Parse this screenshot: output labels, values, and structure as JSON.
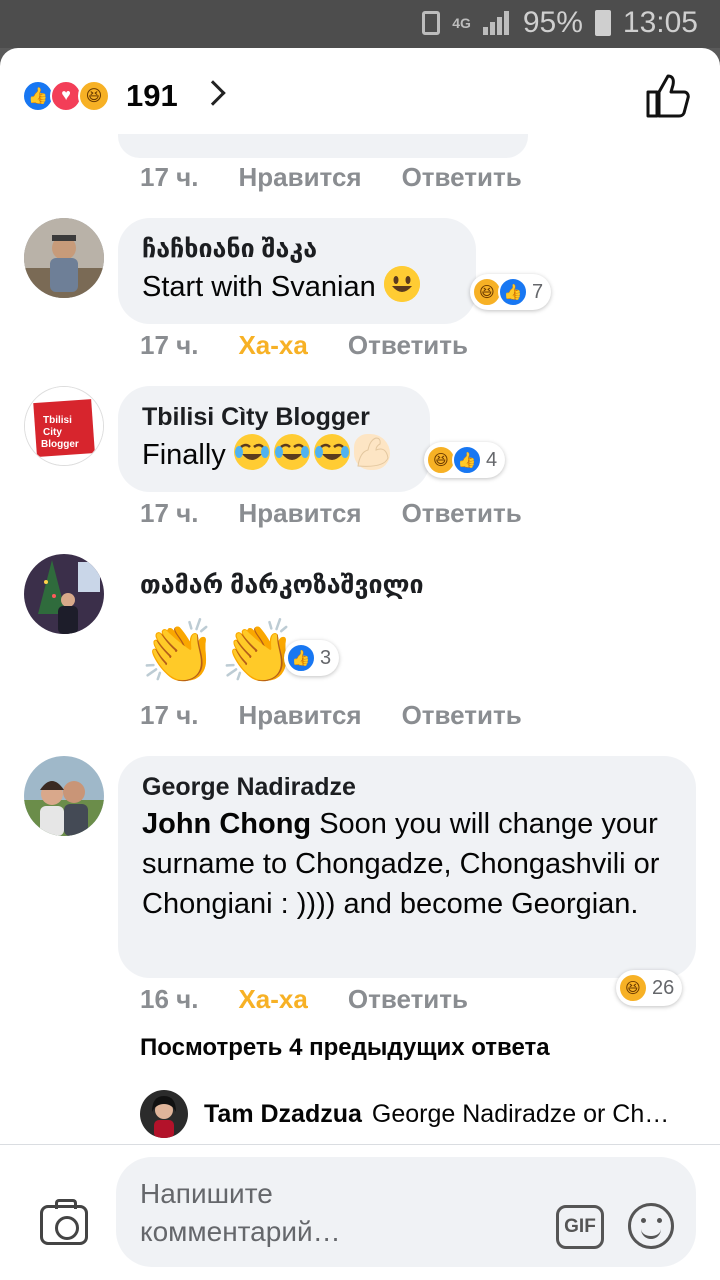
{
  "status_bar": {
    "network": "4G",
    "battery": "95%",
    "time": "13:05"
  },
  "header": {
    "reaction_count": "191",
    "reaction_icons": [
      "like-icon",
      "love-icon",
      "haha-icon"
    ]
  },
  "colors": {
    "like": "#1877f2",
    "love": "#f33e58",
    "haha": "#f7b125",
    "bubble": "#f0f2f5",
    "meta": "#8a8d91"
  },
  "top_meta": {
    "time": "17 ч.",
    "like": "Нравится",
    "reply": "Ответить"
  },
  "comments": [
    {
      "name": "ჩაჩხიანი შაკა",
      "text": "Start with Svanian",
      "time": "17 ч.",
      "reaction_label": "Ха-ха",
      "reply": "Ответить",
      "reactions": [
        "haha",
        "like"
      ],
      "reaction_count": "7"
    },
    {
      "name": "Tbilisi Cìty Blogger",
      "text": "Finally",
      "time": "17 ч.",
      "reaction_label": "Нравится",
      "reply": "Ответить",
      "reactions": [
        "haha",
        "like"
      ],
      "reaction_count": "4",
      "avatar_logo": "Tbilisi City Blogger"
    },
    {
      "name": "თამარ მარკოზაშვილი",
      "text": "",
      "time": "17 ч.",
      "reaction_label": "Нравится",
      "reply": "Ответить",
      "reactions": [
        "like"
      ],
      "reaction_count": "3"
    },
    {
      "name": "George Nadiradze",
      "mention": "John Chong",
      "text": " Soon you will change your surname to Chongadze, Chongashvili or Chongiani : )))) and become Georgian.",
      "time": "16 ч.",
      "reaction_label": "Ха-ха",
      "reply": "Ответить",
      "reactions": [
        "haha"
      ],
      "reaction_count": "26"
    }
  ],
  "view_more": "Посмотреть 4 предыдущих ответа",
  "latest_reply": {
    "name": "Tam Dzadzua",
    "text": "George Nadiradze or Ch…"
  },
  "composer": {
    "placeholder": "Напишите комментарий…",
    "gif_label": "GIF"
  }
}
